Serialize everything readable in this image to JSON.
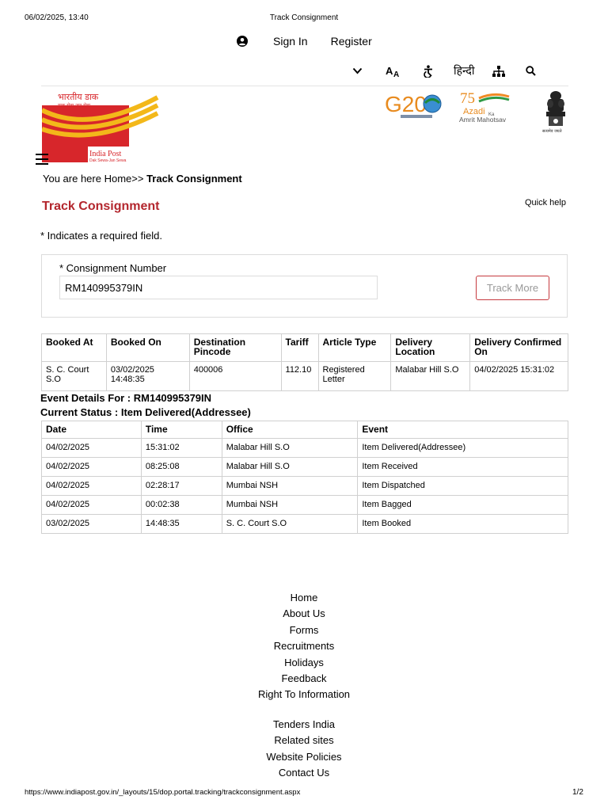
{
  "print_header": {
    "date": "06/02/2025, 13:40",
    "title": "Track Consignment"
  },
  "top_links": {
    "signin": "Sign In",
    "register": "Register"
  },
  "toolbar": {
    "hindi": "हिन्दी"
  },
  "logos": {
    "brand": "India Post",
    "tagline": "Dak Sewa-Jan Sewa",
    "hindi_brand": "भारतीय डाक",
    "hindi_tagline": "डाक सेवा-जन सेवा",
    "g20": "G20",
    "azadi": "Azadi",
    "ka": "Ka",
    "amrit": "Amrit Mahotsav",
    "emblem_text": "सत्यमेव जयते"
  },
  "breadcrumb": {
    "prefix": "You are here Home>> ",
    "current": "Track Consignment"
  },
  "page_title": "Track Consignment",
  "quick_help": "Quick help",
  "required_note": "* Indicates a required field.",
  "form": {
    "label": "* Consignment Number",
    "value": "RM140995379IN",
    "button": "Track More"
  },
  "summary_table": {
    "headers": [
      "Booked At",
      "Booked On",
      "Destination Pincode",
      "Tariff",
      "Article Type",
      "Delivery Location",
      "Delivery Confirmed On"
    ],
    "row": [
      "S. C. Court S.O",
      "03/02/2025 14:48:35",
      "400006",
      "112.10",
      "Registered Letter",
      "Malabar Hill S.O",
      "04/02/2025 15:31:02"
    ]
  },
  "event_details": "Event Details For : RM140995379IN",
  "current_status": "Current Status : Item Delivered(Addressee)",
  "events_table": {
    "headers": [
      "Date",
      "Time",
      "Office",
      "Event"
    ],
    "rows": [
      [
        "04/02/2025",
        "15:31:02",
        "Malabar Hill S.O",
        "Item Delivered(Addressee)"
      ],
      [
        "04/02/2025",
        "08:25:08",
        "Malabar Hill S.O",
        "Item Received"
      ],
      [
        "04/02/2025",
        "02:28:17",
        "Mumbai NSH",
        "Item Dispatched"
      ],
      [
        "04/02/2025",
        "00:02:38",
        "Mumbai NSH",
        "Item Bagged"
      ],
      [
        "03/02/2025",
        "14:48:35",
        "S. C. Court S.O",
        "Item Booked"
      ]
    ]
  },
  "footer": {
    "group1": [
      "Home",
      "About Us",
      "Forms",
      "Recruitments",
      "Holidays",
      "Feedback",
      "Right To Information"
    ],
    "group2": [
      "Tenders India",
      "Related sites",
      "Website Policies",
      "Contact Us"
    ]
  },
  "print_footer": {
    "url": "https://www.indiapost.gov.in/_layouts/15/dop.portal.tracking/trackconsignment.aspx",
    "page": "1/2"
  },
  "colors": {
    "heading_red": "#b3262d",
    "logo_red": "#d7262b",
    "logo_yellow": "#f3b81a"
  }
}
